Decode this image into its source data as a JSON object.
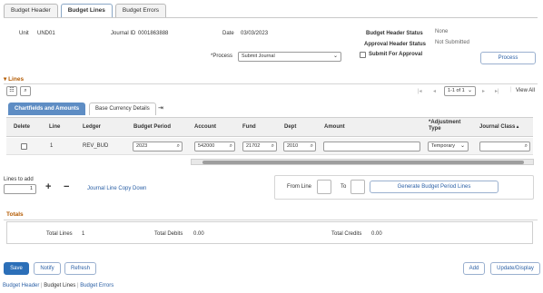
{
  "page_tabs": [
    "Budget Header",
    "Budget Lines",
    "Budget Errors"
  ],
  "header": {
    "unit_label": "Unit",
    "unit_value": "UND01",
    "journal_id_label": "Journal ID",
    "journal_id_value": "0001863888",
    "date_label": "Date",
    "date_value": "03/03/2023",
    "budget_header_status_label": "Budget Header Status",
    "budget_header_status_value": "None",
    "approval_header_status_label": "Approval Header Status",
    "approval_header_status_value": "Not Submitted",
    "process_label": "*Process",
    "process_value": "Submit Journal",
    "submit_for_approval_label": "Submit For Approval",
    "process_button": "Process"
  },
  "lines": {
    "section_title": "Lines",
    "pagination": "1-1 of 1",
    "view_all": "View All",
    "subtabs": [
      "Chartfields and Amounts",
      "Base Currency Details"
    ],
    "columns": [
      "Delete",
      "Line",
      "Ledger",
      "Budget Period",
      "Account",
      "Fund",
      "Dept",
      "Amount",
      "*Adjustment Type",
      "Journal Class"
    ],
    "adjustment_type_header_line1": "*Adjustment",
    "adjustment_type_header_line2": "Type",
    "row": {
      "line": "1",
      "ledger": "REV_BUD",
      "budget_period": "2023",
      "account": "542000",
      "fund": "21702",
      "dept": "2010",
      "amount": "",
      "adjustment_type": "Temporary",
      "journal_class": ""
    },
    "lines_to_add_label": "Lines to add",
    "lines_to_add_value": "1",
    "copy_down_link": "Journal Line Copy Down",
    "from_line_label": "From Line",
    "to_label": "To",
    "generate_button": "Generate Budget Period Lines"
  },
  "totals": {
    "section_title": "Totals",
    "total_lines_label": "Total Lines",
    "total_lines_value": "1",
    "total_debits_label": "Total Debits",
    "total_debits_value": "0.00",
    "total_credits_label": "Total Credits",
    "total_credits_value": "0.00"
  },
  "footer": {
    "save": "Save",
    "notify": "Notify",
    "refresh": "Refresh",
    "add": "Add",
    "update_display": "Update/Display",
    "links": [
      "Budget Header",
      "Budget Lines",
      "Budget Errors"
    ],
    "separator": "|"
  },
  "colors": {
    "accent": "#2c6fb8",
    "section": "#b35a00",
    "active_subtab": "#5e8dc4"
  }
}
